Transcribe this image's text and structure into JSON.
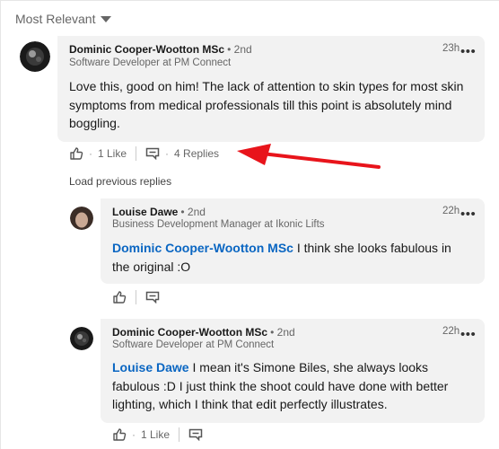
{
  "sort": {
    "label": "Most Relevant"
  },
  "comment": {
    "author": "Dominic Cooper-Wootton MSc",
    "degree": "• 2nd",
    "headline": "Software Developer at PM Connect",
    "time": "23h",
    "more": "•••",
    "text": "Love this, good on him! The lack of attention to skin types for most skin symptoms from medical professionals till this point is absolutely mind boggling.",
    "likes": "1 Like",
    "replies": "4 Replies"
  },
  "load_previous": "Load previous replies",
  "replies": [
    {
      "author": "Louise Dawe",
      "degree": "• 2nd",
      "headline": "Business Development Manager at Ikonic Lifts",
      "time": "22h",
      "more": "•••",
      "mention": "Dominic Cooper-Wootton MSc",
      "text": " I think she looks fabulous in the original :O"
    },
    {
      "author": "Dominic Cooper-Wootton MSc",
      "degree": "• 2nd",
      "headline": "Software Developer at PM Connect",
      "time": "22h",
      "more": "•••",
      "mention": "Louise Dawe",
      "text": " I mean it's Simone Biles, she always looks fabulous :D I just think the shoot could have done with better lighting, which I think that edit perfectly illustrates.",
      "likes": "1 Like"
    }
  ],
  "colors": {
    "accent": "#0a66c2",
    "arrow": "#e8141b",
    "bubble": "#f2f2f2"
  }
}
